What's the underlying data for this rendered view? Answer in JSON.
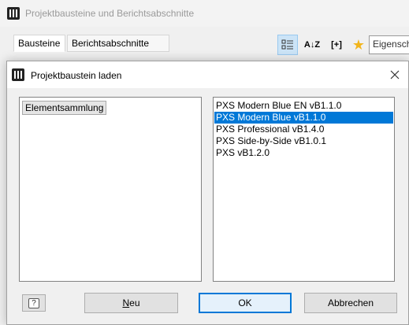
{
  "background_window": {
    "title": "Projektbausteine und Berichtsabschnitte",
    "tabs": [
      {
        "label": "Bausteine",
        "active": true
      },
      {
        "label": "Berichtsabschnitte",
        "active": false
      }
    ],
    "toolbar": {
      "az_label": "A↓Z",
      "bracket_label": "[+]",
      "search_value": "Eigenscha"
    }
  },
  "dialog": {
    "title": "Projektbaustein laden",
    "left_tree": {
      "items": [
        "Elementsammlung"
      ]
    },
    "right_list": {
      "items": [
        {
          "label": "PXS Modern Blue EN vB1.1.0",
          "selected": false
        },
        {
          "label": "PXS Modern Blue vB1.1.0",
          "selected": true
        },
        {
          "label": "PXS Professional vB1.4.0",
          "selected": false
        },
        {
          "label": "PXS Side-by-Side vB1.0.1",
          "selected": false
        },
        {
          "label": "PXS vB1.2.0",
          "selected": false
        }
      ]
    },
    "buttons": {
      "help_label": "?",
      "new_label": "Neu",
      "ok_label": "OK",
      "cancel_label": "Abbrechen"
    }
  },
  "colors": {
    "selection": "#0078d7",
    "accent_star": "#f2b51c"
  }
}
